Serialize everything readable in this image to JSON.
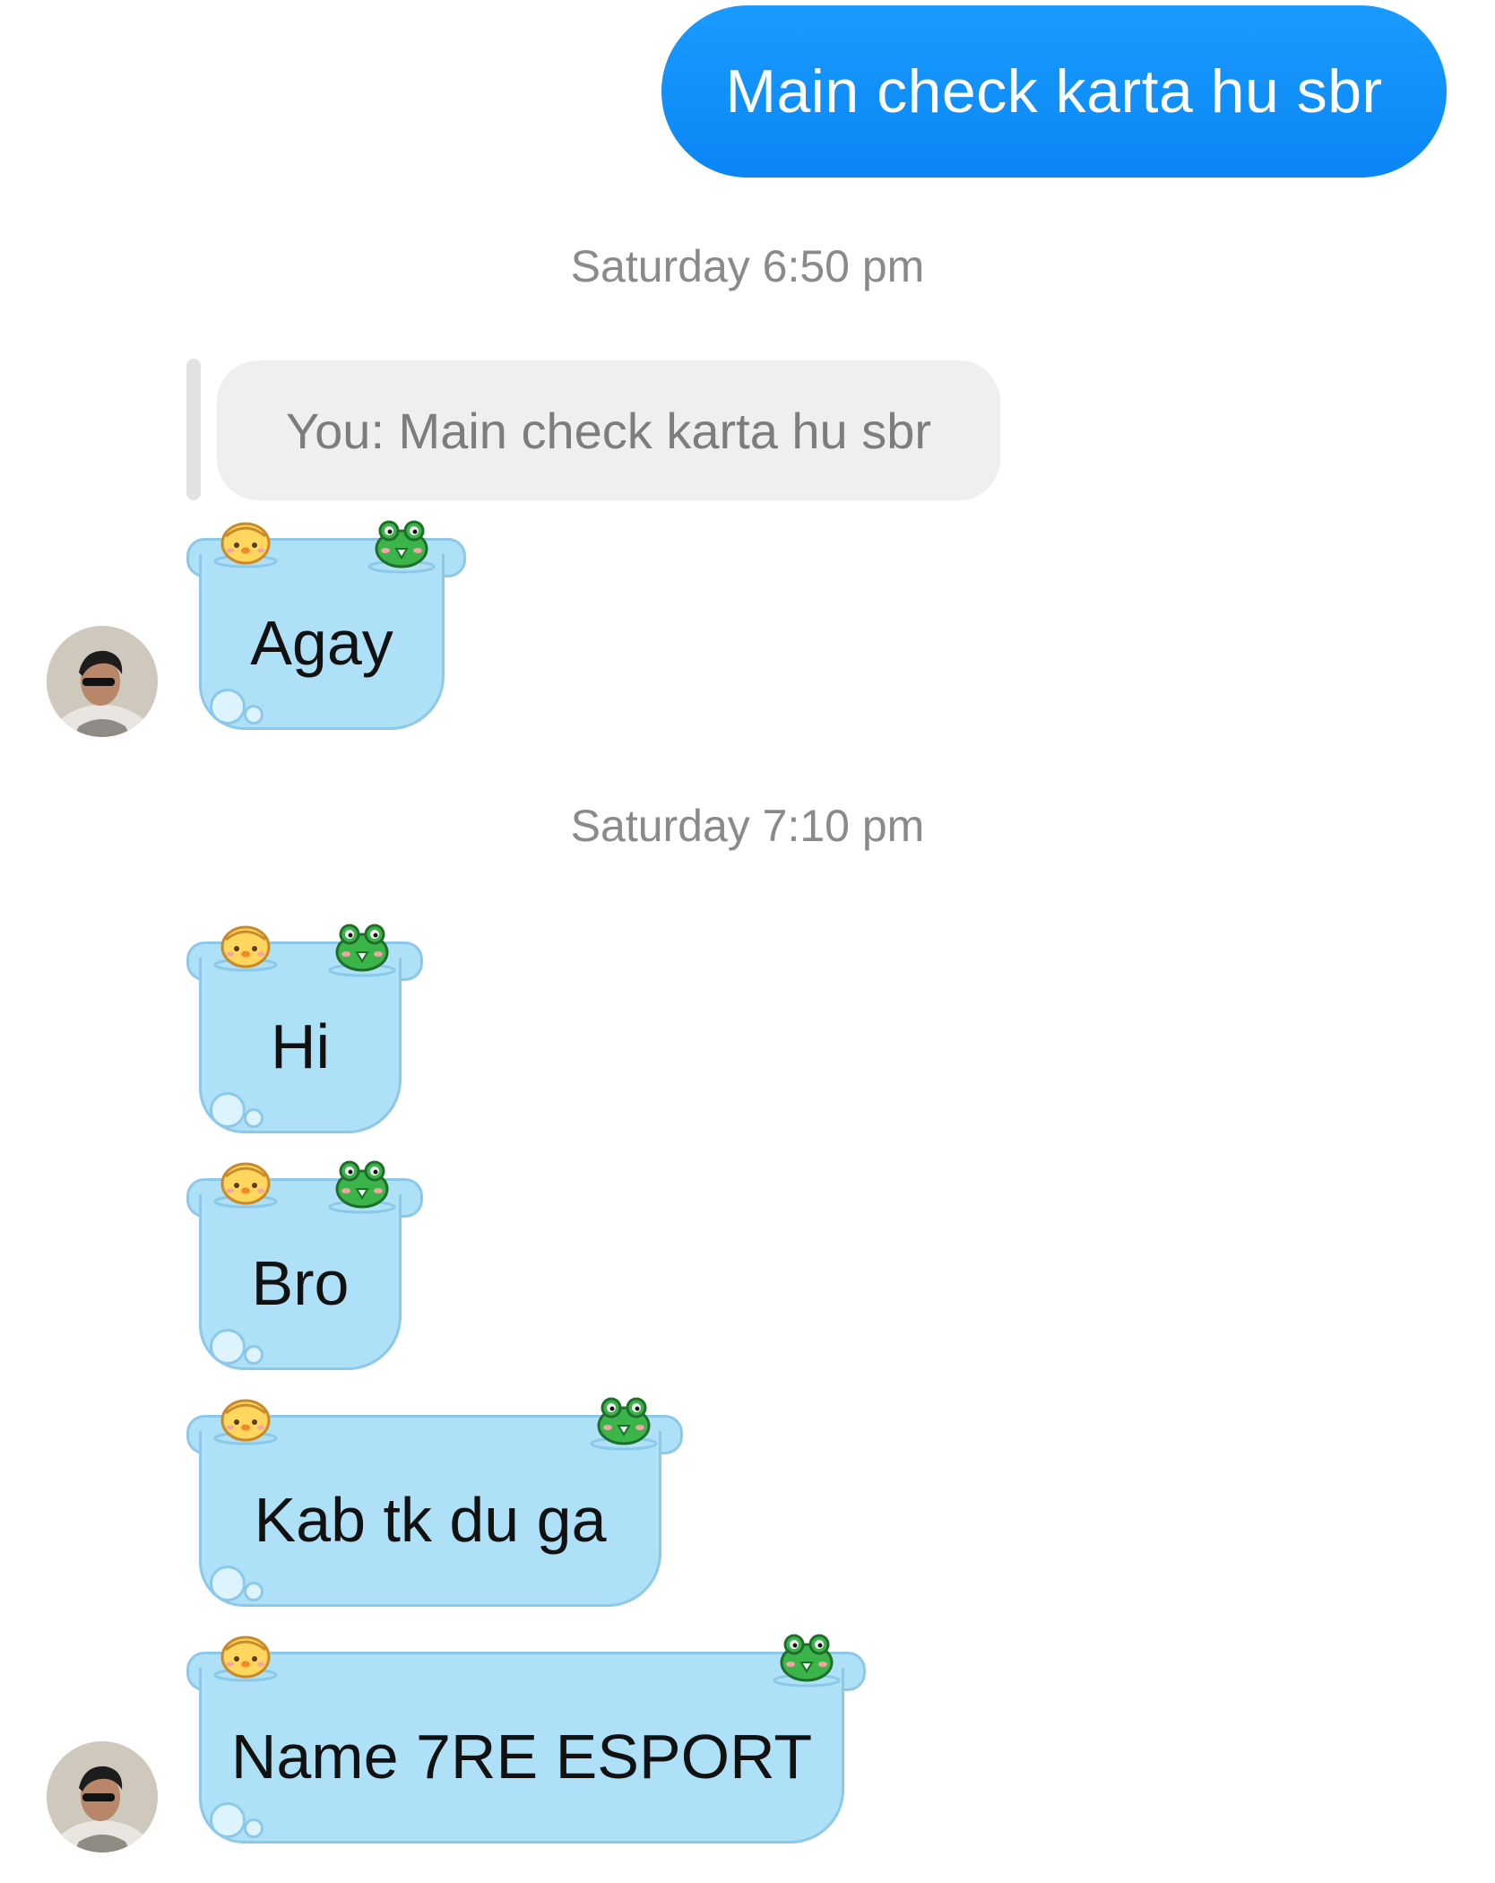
{
  "messages": {
    "sent_text": "Main check karta hu sbr",
    "timestamp_1": "Saturday 6:50 pm",
    "reply_preview": "You: Main check karta hu sbr",
    "received_1": "Agay",
    "timestamp_2": "Saturday 7:10 pm",
    "received_2": "Hi",
    "received_3": "Bro",
    "received_4": "Kab tk du ga",
    "received_5": "Name 7RE ESPORT"
  },
  "colors": {
    "sent_bubble": "#0a86f5",
    "received_bubble": "#aee0f7",
    "received_border": "#8cc8ea",
    "timestamp_text": "#8a8a8a",
    "reply_bg": "#efefef"
  },
  "icons": {
    "bubble_deco_left": "chick-sticker-icon",
    "bubble_deco_right": "frog-sticker-icon",
    "avatar": "contact-avatar"
  }
}
